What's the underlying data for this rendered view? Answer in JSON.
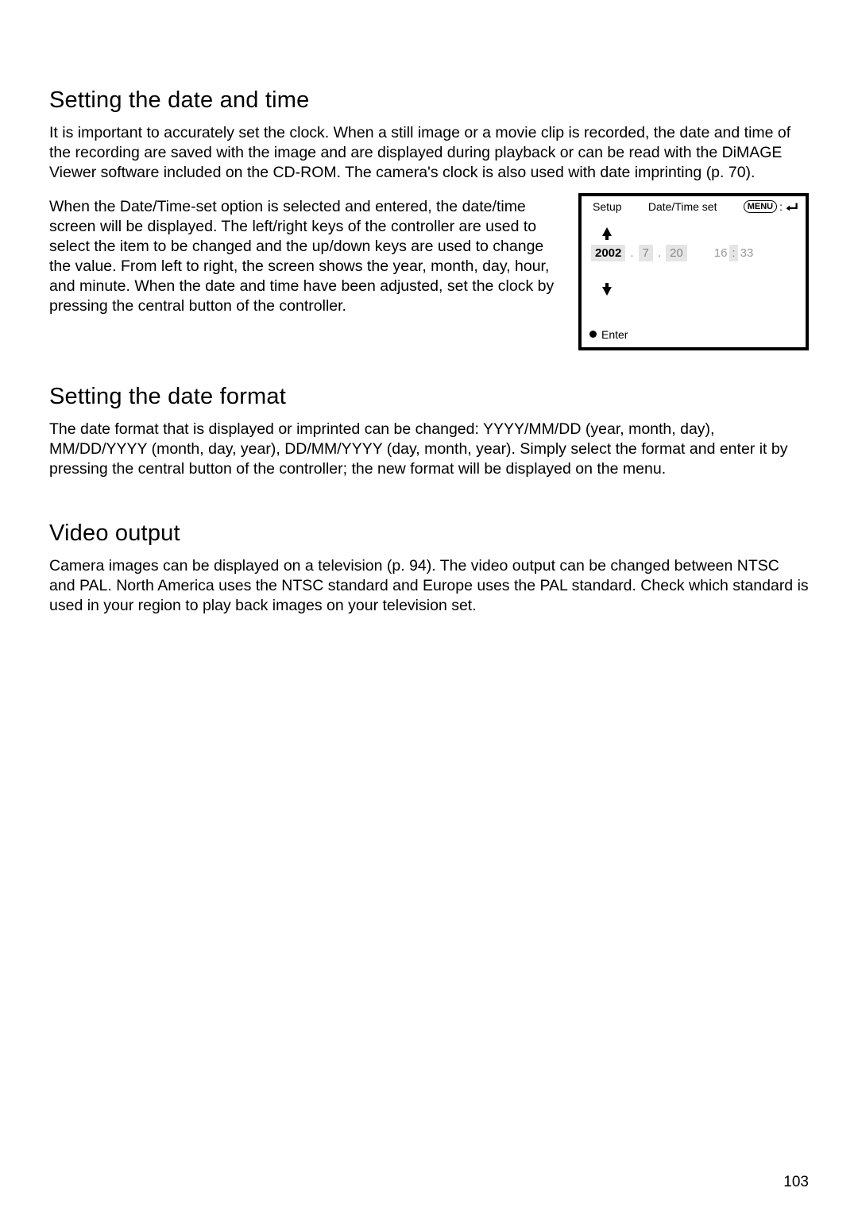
{
  "section1": {
    "heading": "Setting the date and time",
    "para1": "It is important to accurately set the clock. When a still image or a movie clip is recorded, the date and time of the recording are saved with the image and are displayed during playback or can be read with the DiMAGE Viewer software included on the CD-ROM. The camera's clock is also used with date imprinting (p. 70).",
    "para2": "When the Date/Time-set option is selected and entered, the date/time screen will be displayed. The left/right keys of the controller are used to select the item to be changed and the up/down keys are used to change the value. From left to right, the screen shows the year, month, day, hour, and minute. When the date and time have been adjusted, set the clock by pressing the central button of the controller."
  },
  "section2": {
    "heading": "Setting the date format",
    "para": "The date format that is displayed or imprinted can be changed: YYYY/MM/DD (year, month, day), MM/DD/YYYY (month, day, year), DD/MM/YYYY (day, month, year). Simply select the format and enter it by pressing the central button of the controller; the new format will be displayed on the menu."
  },
  "section3": {
    "heading": "Video output",
    "para": "Camera images can be displayed on a television (p. 94). The video output can be changed between NTSC and PAL. North America uses the NTSC standard and Europe uses the PAL standard. Check which standard is used in your region to play back images on your television set."
  },
  "screen": {
    "setup_label": "Setup",
    "title_label": "Date/Time set",
    "menu_label": "MENU",
    "year": "2002",
    "month": "7",
    "day": "20",
    "hour": "16",
    "minute": "33",
    "dot": ".",
    "colon": ":",
    "enter_label": "Enter"
  },
  "page_number": "103"
}
